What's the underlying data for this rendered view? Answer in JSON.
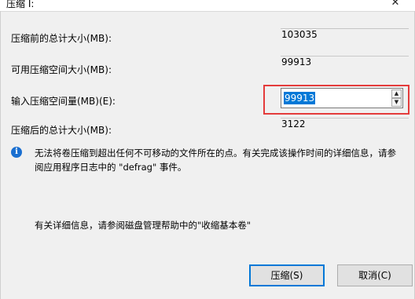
{
  "window": {
    "title": "压缩 I:",
    "close_glyph": "✕"
  },
  "fields": {
    "total_before_label": "压缩前的总计大小(MB):",
    "total_before_value": "103035",
    "available_label": "可用压缩空间大小(MB):",
    "available_value": "99913",
    "input_label": "输入压缩空间量(MB)(E):",
    "input_value": "99913",
    "total_after_label": "压缩后的总计大小(MB):",
    "total_after_value": "3122"
  },
  "info": {
    "icon_glyph": "i",
    "text": "无法将卷压缩到超出任何不可移动的文件所在的点。有关完成该操作时间的详细信息，请参阅应用程序日志中的 \"defrag\" 事件。",
    "help_text": "有关详细信息，请参阅磁盘管理帮助中的\"收缩基本卷\""
  },
  "buttons": {
    "shrink_label": "压缩(S)",
    "cancel_label": "取消(C)"
  },
  "spinner": {
    "up_glyph": "▲",
    "down_glyph": "▼"
  },
  "colors": {
    "highlight": "#e43b3b",
    "selection": "#0078d7",
    "info_icon": "#1a6fd0"
  }
}
